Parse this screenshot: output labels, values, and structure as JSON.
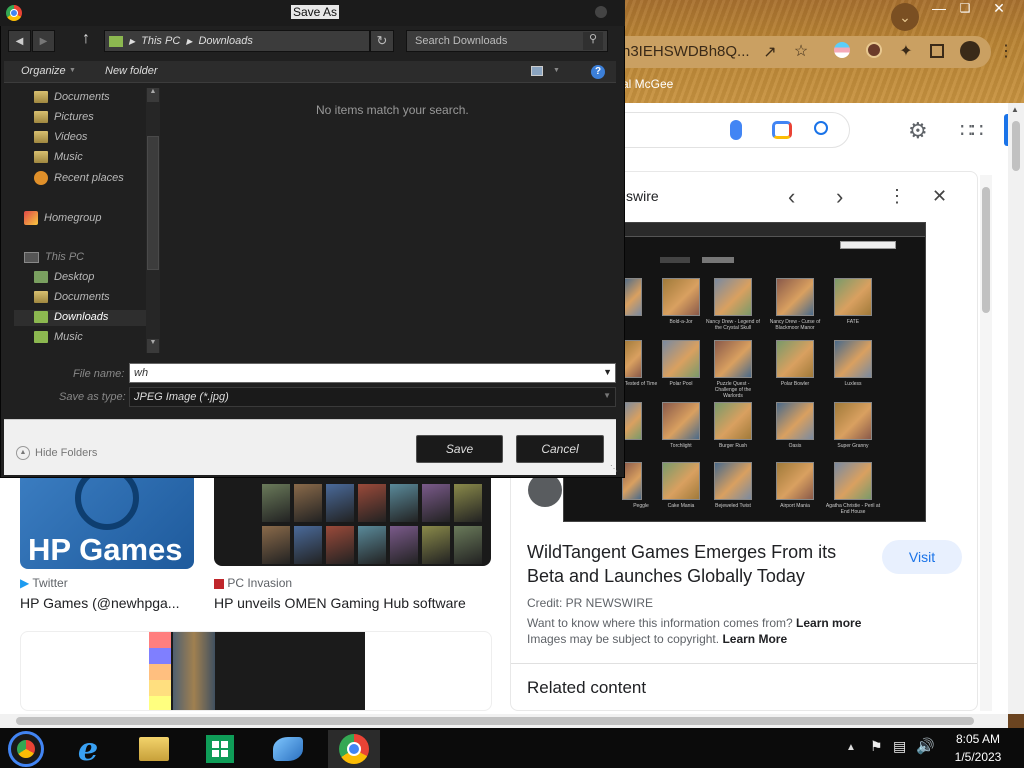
{
  "browser": {
    "url_text": "n3IEHSWDBh8Q...",
    "profile_text": "al McGee"
  },
  "google": {
    "right_card": {
      "header_fragment": "swire",
      "title": "WildTangent Games Emerges From its Beta and Launches Globally Today",
      "visit_label": "Visit",
      "credit": "Credit: PR NEWSWIRE",
      "info_text": "Want to know where this information comes from?",
      "learn_more_1": "Learn more",
      "copyright_text": "Images may be subject to copyright.",
      "learn_more_2": "Learn More",
      "related": "Related content",
      "thumb_captions": [
        "",
        "Bold-a-Jor",
        "Nancy Drew - Legend of the Crystal Skull",
        "Nancy Drew - Curse of Blackmoor Manor",
        "FATE",
        "Tested of Time",
        "Polar Pool",
        "Puzzle Quest - Challenge of the Warlords",
        "Polar Bowler",
        "Luxless",
        "",
        "Torchlight",
        "Burger Rush",
        "Oasis",
        "Super Granny",
        "Peggle",
        "Cake Mania",
        "Bejeweled Twist",
        "Airport Mania",
        "Agatha Christie - Peril at End House"
      ]
    },
    "results": [
      {
        "source": "Twitter",
        "title": "HP Games (@newhpga..."
      },
      {
        "source": "PC Invasion",
        "title": "HP unveils OMEN Gaming Hub software"
      }
    ],
    "hp_logo_text": "HP Games"
  },
  "dialog": {
    "title": "Save As",
    "breadcrumb": [
      "This PC",
      "Downloads"
    ],
    "search_placeholder": "Search Downloads",
    "organize_label": "Organize",
    "new_folder_label": "New folder",
    "empty_message": "No items match your search.",
    "nav_items": [
      {
        "label": "Documents",
        "icon": "documents-folder-icon"
      },
      {
        "label": "Pictures",
        "icon": "pictures-folder-icon"
      },
      {
        "label": "Videos",
        "icon": "videos-folder-icon"
      },
      {
        "label": "Music",
        "icon": "music-folder-icon"
      },
      {
        "label": "Recent places",
        "icon": "recent-places-icon"
      },
      {
        "label": "Homegroup",
        "icon": "homegroup-icon"
      },
      {
        "label": "This PC",
        "icon": "this-pc-icon"
      },
      {
        "label": "Desktop",
        "icon": "desktop-folder-icon"
      },
      {
        "label": "Documents",
        "icon": "documents-folder-icon"
      },
      {
        "label": "Downloads",
        "icon": "downloads-folder-icon"
      },
      {
        "label": "Music",
        "icon": "music-folder-icon"
      }
    ],
    "file_name_label": "File name:",
    "file_name_value": "wh",
    "save_as_type_label": "Save as type:",
    "save_as_type_value": "JPEG Image (*.jpg)",
    "hide_folders_label": "Hide Folders",
    "save_label": "Save",
    "cancel_label": "Cancel"
  },
  "taskbar": {
    "time": "8:05 AM",
    "date": "1/5/2023"
  }
}
